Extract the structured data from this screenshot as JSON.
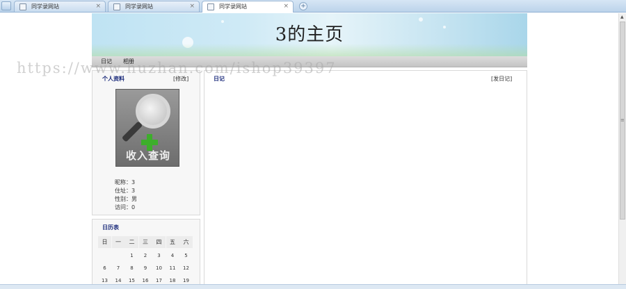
{
  "tabs": [
    {
      "label": "同学录网站",
      "active": false
    },
    {
      "label": "同学录网站",
      "active": false
    },
    {
      "label": "同学录网站",
      "active": true
    }
  ],
  "banner": {
    "title": "3的主页"
  },
  "nav": {
    "items": [
      "日记",
      "相册"
    ]
  },
  "watermark": "https://www.huzhan.com/ishop39397",
  "profile": {
    "title": "个人资料",
    "action": "[修改]",
    "photo_caption": "收入查询",
    "fields": [
      {
        "label": "昵称",
        "value": "3"
      },
      {
        "label": "住址",
        "value": "3"
      },
      {
        "label": "性别",
        "value": "男"
      },
      {
        "label": "访问",
        "value": "0"
      }
    ]
  },
  "calendar": {
    "title": "日历表",
    "weekdays": [
      "日",
      "一",
      "二",
      "三",
      "四",
      "五",
      "六"
    ],
    "weeks": [
      [
        "",
        "",
        "1",
        "2",
        "3",
        "4",
        "5"
      ],
      [
        "6",
        "7",
        "8",
        "9",
        "10",
        "11",
        "12"
      ],
      [
        "13",
        "14",
        "15",
        "16",
        "17",
        "18",
        "19"
      ]
    ]
  },
  "diary": {
    "title": "日记",
    "action": "[发日记]"
  },
  "colors": {
    "panel_title": "#1a2a7a",
    "nav_bg": "#cfcfcf",
    "accent_green": "#3dae2b"
  }
}
